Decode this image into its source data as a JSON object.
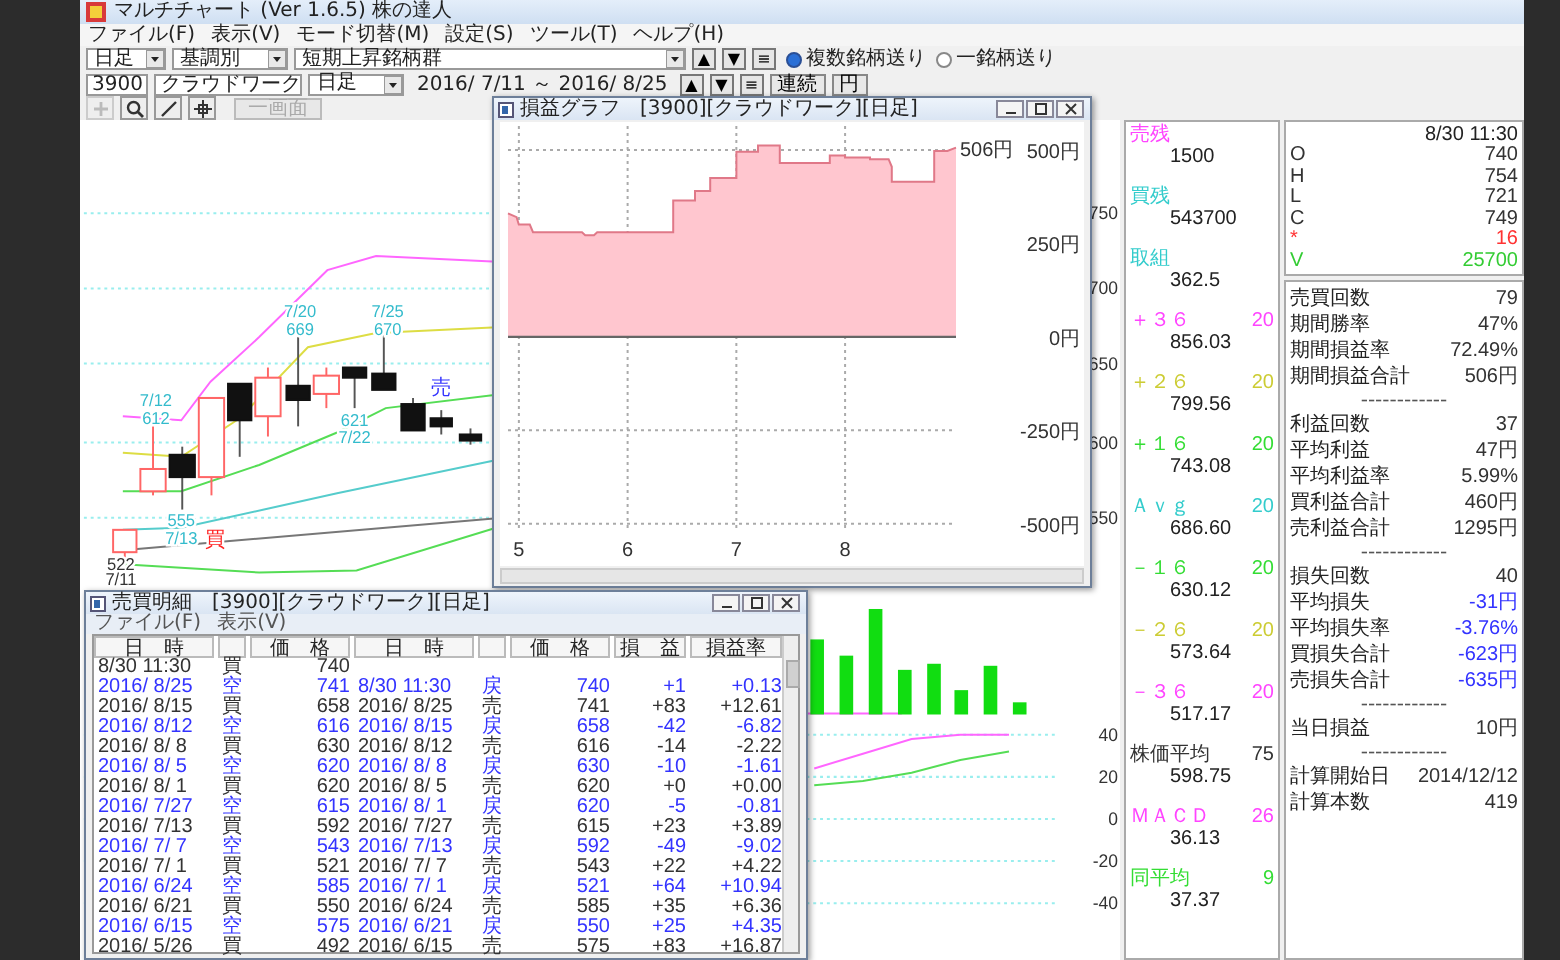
{
  "window": {
    "title": "マルチチャート (Ver 1.6.5)  株の達人"
  },
  "menu": [
    "ファイル(F)",
    "表示(V)",
    "モード切替(M)",
    "設定(S)",
    "ツール(T)",
    "ヘルプ(H)"
  ],
  "toolbar1": {
    "period": "日足",
    "sort": "基調別",
    "group": "短期上昇銘柄群",
    "arrows": [
      "▲",
      "▼",
      "≡"
    ],
    "modes": [
      {
        "label": "複数銘柄送り",
        "selected": true
      },
      {
        "label": "一銘柄送り",
        "selected": false
      }
    ]
  },
  "toolbar2": {
    "code": "3900",
    "name": "クラウドワーク",
    "period": "日足",
    "range": "2016/ 7/11 ～ 2016/ 8/25",
    "arrows": [
      "▲",
      "▼",
      "≡"
    ],
    "buttons": [
      "連続",
      "円"
    ]
  },
  "toolbar3": {
    "tools": [
      {
        "disabled": true
      },
      {
        "disabled": false
      },
      {
        "disabled": false
      },
      {
        "disabled": false
      }
    ],
    "button": {
      "label": "一画面",
      "disabled": true
    }
  },
  "chart": {
    "price_axis": [
      "750",
      "700",
      "650",
      "600",
      "550"
    ],
    "labels": [
      {
        "text": "7/12",
        "color": "#33bbcc"
      },
      {
        "text": "612",
        "color": "#33bbcc"
      },
      {
        "text": "7/20",
        "color": "#33bbcc"
      },
      {
        "text": "669",
        "color": "#33bbcc"
      },
      {
        "text": "7/25",
        "color": "#33bbcc"
      },
      {
        "text": "670",
        "color": "#33bbcc"
      },
      {
        "text": "売",
        "color": "#3333ff"
      },
      {
        "text": "621",
        "color": "#33bbcc"
      },
      {
        "text": "7/22",
        "color": "#33bbcc"
      },
      {
        "text": "555",
        "color": "#33bbcc"
      },
      {
        "text": "7/13",
        "color": "#33bbcc"
      },
      {
        "text": "買",
        "color": "#ff2222"
      },
      {
        "text": "522",
        "color": "#333333"
      },
      {
        "text": "7/11",
        "color": "#333333"
      }
    ],
    "oscillator": {
      "chart_data": {
        "type": "line",
        "categories": [
          null,
          null,
          null,
          null,
          null,
          null,
          null,
          null,
          null,
          null,
          null,
          null,
          null,
          null,
          null,
          null,
          null,
          null,
          null,
          null,
          null
        ],
        "series": [
          {
            "color": "#ff66ff",
            "values": [
              null,
              null,
              null,
              null,
              null,
              null,
              null,
              null,
              null,
              null,
              null,
              null,
              null,
              null,
              null,
              24,
              31,
              38,
              40,
              40,
              null
            ]
          },
          {
            "color": "#55dd55",
            "values": [
              null,
              null,
              null,
              null,
              null,
              null,
              null,
              null,
              null,
              null,
              null,
              null,
              null,
              null,
              null,
              16,
              18,
              22,
              28,
              32,
              null
            ]
          }
        ],
        "ylim": [
          -40,
          40
        ],
        "yticks": [
          40,
          20,
          0,
          -20,
          -40
        ],
        "grid": true
      }
    }
  },
  "indicators": [
    {
      "label": "売残",
      "value": "1500",
      "color": "#ff44ff"
    },
    {
      "label": "買残",
      "value": "543700",
      "color": "#33cccc"
    },
    {
      "label": "取組",
      "value": "362.5",
      "color": "#33cccc"
    },
    {
      "label": "＋３６",
      "param": "20",
      "value": "856.03",
      "color": "#ff44ff"
    },
    {
      "label": "＋２６",
      "param": "20",
      "value": "799.56",
      "color": "#cccc33"
    },
    {
      "label": "＋１６",
      "param": "20",
      "value": "743.08",
      "color": "#33dd33"
    },
    {
      "label": "Ａｖｇ",
      "param": "20",
      "value": "686.60",
      "color": "#33cccc"
    },
    {
      "label": "－１６",
      "param": "20",
      "value": "630.12",
      "color": "#33dd33"
    },
    {
      "label": "－２６",
      "param": "20",
      "value": "573.64",
      "color": "#cccc33"
    },
    {
      "label": "－３６",
      "param": "20",
      "value": "517.17",
      "color": "#ff44ff"
    },
    {
      "label": "株価平均",
      "param": "75",
      "value": "598.75",
      "color": "#333333"
    },
    {
      "label": "ＭＡＣＤ",
      "param": "26",
      "value": "36.13",
      "color": "#ff44ff"
    },
    {
      "label": "同平均",
      "param": "9",
      "value": "37.37",
      "color": "#33dd33"
    }
  ],
  "quote": {
    "time": "8/30 11:30",
    "rows": [
      {
        "label": "O",
        "value": "740",
        "color": "#333333"
      },
      {
        "label": "H",
        "value": "754",
        "color": "#333333"
      },
      {
        "label": "L",
        "value": "721",
        "color": "#333333"
      },
      {
        "label": "C",
        "value": "749",
        "color": "#333333"
      },
      {
        "label": "*",
        "value": "16",
        "color": "#ff3333"
      },
      {
        "label": "V",
        "value": "25700",
        "color": "#33cc33"
      }
    ]
  },
  "stats": [
    {
      "kind": "stat",
      "label": "売買回数",
      "value": "79",
      "color": "#333333"
    },
    {
      "kind": "stat",
      "label": "期間勝率",
      "value": "47%",
      "color": "#333333"
    },
    {
      "kind": "stat",
      "label": "期間損益率",
      "value": "72.49%",
      "color": "#333333"
    },
    {
      "kind": "stat",
      "label": "期間損益合計",
      "value": "506円",
      "color": "#333333"
    },
    {
      "kind": "separator",
      "label": "------------"
    },
    {
      "kind": "stat",
      "label": "利益回数",
      "value": "37",
      "color": "#333333"
    },
    {
      "kind": "stat",
      "label": "平均利益",
      "value": "47円",
      "color": "#333333"
    },
    {
      "kind": "stat",
      "label": "平均利益率",
      "value": "5.99%",
      "color": "#333333"
    },
    {
      "kind": "stat",
      "label": "買利益合計",
      "value": "460円",
      "color": "#333333"
    },
    {
      "kind": "stat",
      "label": "売利益合計",
      "value": "1295円",
      "color": "#333333"
    },
    {
      "kind": "separator",
      "label": "------------"
    },
    {
      "kind": "stat",
      "label": "損失回数",
      "value": "40",
      "color": "#333333"
    },
    {
      "kind": "stat",
      "label": "平均損失",
      "value": "-31円",
      "color": "#3333ff"
    },
    {
      "kind": "stat",
      "label": "平均損失率",
      "value": "-3.76%",
      "color": "#3333ff"
    },
    {
      "kind": "stat",
      "label": "買損失合計",
      "value": "-623円",
      "color": "#3333ff"
    },
    {
      "kind": "stat",
      "label": "売損失合計",
      "value": "-635円",
      "color": "#3333ff"
    },
    {
      "kind": "separator",
      "label": "------------"
    },
    {
      "kind": "stat",
      "label": "当日損益",
      "value": "10円",
      "color": "#333333"
    },
    {
      "kind": "separator",
      "label": "------------"
    },
    {
      "kind": "stat",
      "label": "計算開始日",
      "value": "2014/12/12",
      "color": "#333333"
    },
    {
      "kind": "stat",
      "label": "計算本数",
      "value": "419",
      "color": "#333333"
    }
  ],
  "profit_window": {
    "title": "損益グラフ　[3900][クラウドワーク][日足]",
    "chart_data": {
      "type": "area",
      "x": [
        4.9,
        4.98,
        5.0,
        5.1,
        5.13,
        5.58,
        5.61,
        5.69,
        5.72,
        6.42,
        6.42,
        6.62,
        6.62,
        6.76,
        6.76,
        7.0,
        7.0,
        7.2,
        7.2,
        7.4,
        7.4,
        7.86,
        7.86,
        8.0,
        8.0,
        8.23,
        8.23,
        8.4,
        8.43,
        8.43,
        8.82,
        8.82,
        8.94,
        9.02
      ],
      "series": [
        {
          "color": "#ffc6cf",
          "values": [
            330,
            320,
            300,
            300,
            280,
            280,
            272,
            272,
            280,
            280,
            365,
            365,
            390,
            390,
            425,
            425,
            495,
            495,
            512,
            512,
            465,
            465,
            485,
            485,
            480,
            480,
            475,
            475,
            455,
            415,
            415,
            497,
            497,
            506
          ]
        }
      ],
      "xlim": [
        4.9,
        9.02
      ],
      "ylim": [
        -522,
        564
      ],
      "grid": true,
      "xticks": [
        5,
        6,
        7,
        8
      ],
      "yticks": [
        {
          "value": 500,
          "label": "500円"
        },
        {
          "value": 250,
          "label": "250円"
        },
        {
          "value": 0,
          "label": "0円"
        },
        {
          "value": -250,
          "label": "-250円"
        },
        {
          "value": -500,
          "label": "-500円"
        }
      ],
      "annotations": [
        {
          "x": 9.02,
          "y": 506,
          "text": "506円"
        }
      ]
    }
  },
  "trade_window": {
    "title": "売買明細　[3900][クラウドワーク][日足]",
    "menu": [
      "ファイル(F)",
      "表示(V)"
    ],
    "columns": [
      "日　時",
      "価　格",
      "日　時",
      "価　格",
      "損　益",
      "損益率"
    ],
    "rows": [
      {
        "color": "#333333",
        "open": [
          "8/30 11:30",
          "買",
          "740"
        ]
      },
      {
        "color": "#3333ff",
        "open": [
          "2016/ 8/25",
          "空",
          "741"
        ],
        "close": [
          "8/30 11:30",
          "戻",
          "740"
        ],
        "pl": "+1",
        "rate": "+0.13"
      },
      {
        "color": "#333333",
        "open": [
          "2016/ 8/15",
          "買",
          "658"
        ],
        "close": [
          "2016/ 8/25",
          "売",
          "741"
        ],
        "pl": "+83",
        "rate": "+12.61"
      },
      {
        "color": "#3333ff",
        "open": [
          "2016/ 8/12",
          "空",
          "616"
        ],
        "close": [
          "2016/ 8/15",
          "戻",
          "658"
        ],
        "pl": "-42",
        "rate": "-6.82"
      },
      {
        "color": "#333333",
        "open": [
          "2016/ 8/ 8",
          "買",
          "630"
        ],
        "close": [
          "2016/ 8/12",
          "売",
          "616"
        ],
        "pl": "-14",
        "rate": "-2.22"
      },
      {
        "color": "#3333ff",
        "open": [
          "2016/ 8/ 5",
          "空",
          "620"
        ],
        "close": [
          "2016/ 8/ 8",
          "戻",
          "630"
        ],
        "pl": "-10",
        "rate": "-1.61"
      },
      {
        "color": "#333333",
        "open": [
          "2016/ 8/ 1",
          "買",
          "620"
        ],
        "close": [
          "2016/ 8/ 5",
          "売",
          "620"
        ],
        "pl": "+0",
        "rate": "+0.00"
      },
      {
        "color": "#3333ff",
        "open": [
          "2016/ 7/27",
          "空",
          "615"
        ],
        "close": [
          "2016/ 8/ 1",
          "戻",
          "620"
        ],
        "pl": "-5",
        "rate": "-0.81"
      },
      {
        "color": "#333333",
        "open": [
          "2016/ 7/13",
          "買",
          "592"
        ],
        "close": [
          "2016/ 7/27",
          "売",
          "615"
        ],
        "pl": "+23",
        "rate": "+3.89"
      },
      {
        "color": "#3333ff",
        "open": [
          "2016/ 7/ 7",
          "空",
          "543"
        ],
        "close": [
          "2016/ 7/13",
          "戻",
          "592"
        ],
        "pl": "-49",
        "rate": "-9.02"
      },
      {
        "color": "#333333",
        "open": [
          "2016/ 7/ 1",
          "買",
          "521"
        ],
        "close": [
          "2016/ 7/ 7",
          "売",
          "543"
        ],
        "pl": "+22",
        "rate": "+4.22"
      },
      {
        "color": "#3333ff",
        "open": [
          "2016/ 6/24",
          "空",
          "585"
        ],
        "close": [
          "2016/ 7/ 1",
          "戻",
          "521"
        ],
        "pl": "+64",
        "rate": "+10.94"
      },
      {
        "color": "#333333",
        "open": [
          "2016/ 6/21",
          "買",
          "550"
        ],
        "close": [
          "2016/ 6/24",
          "売",
          "585"
        ],
        "pl": "+35",
        "rate": "+6.36"
      },
      {
        "color": "#3333ff",
        "open": [
          "2016/ 6/15",
          "空",
          "575"
        ],
        "close": [
          "2016/ 6/21",
          "戻",
          "550"
        ],
        "pl": "+25",
        "rate": "+4.35"
      },
      {
        "color": "#333333",
        "open": [
          "2016/ 5/26",
          "買",
          "492"
        ],
        "close": [
          "2016/ 6/15",
          "売",
          "575"
        ],
        "pl": "+83",
        "rate": "+16.87"
      }
    ]
  }
}
